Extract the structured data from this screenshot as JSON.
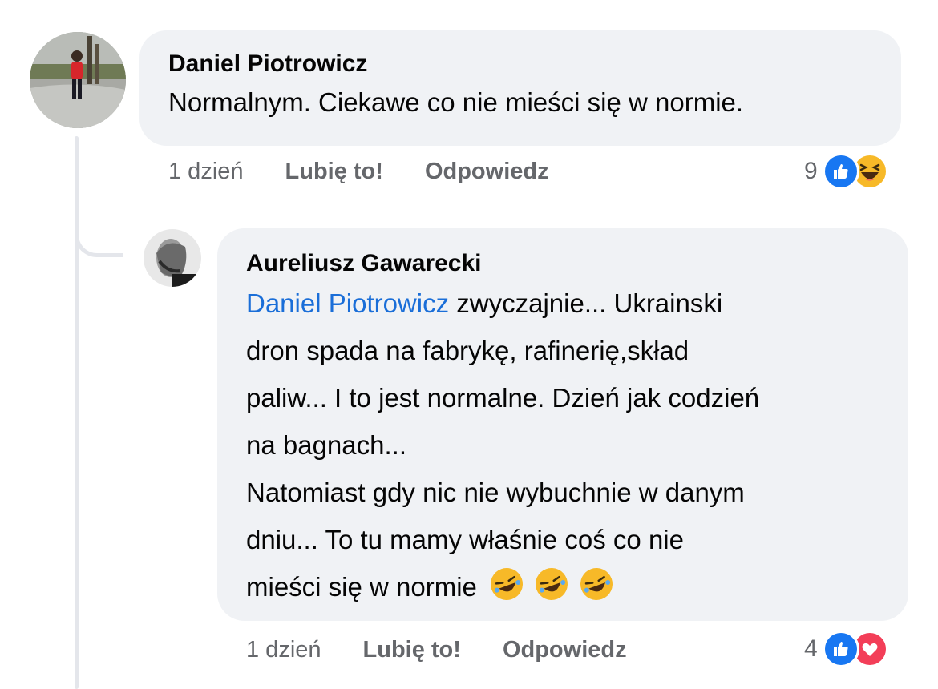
{
  "comments": [
    {
      "author": "Daniel Piotrowicz",
      "text": "Normalnym. Ciekawe co nie mieści się w normie.",
      "time": "1 dzień",
      "like_label": "Lubię to!",
      "reply_label": "Odpowiedz",
      "reaction_count": "9",
      "reactions": [
        "like-icon",
        "haha-icon"
      ]
    }
  ],
  "reply": {
    "author": "Aureliusz Gawarecki",
    "mention": "Daniel Piotrowicz",
    "lines": [
      " zwyczajnie... Ukrainski",
      "dron spada na fabrykę, rafinerię,skład",
      "paliw... I to jest normalne. Dzień jak codzień",
      "na bagnach...",
      "Natomiast gdy nic nie wybuchnie w danym",
      "dniu... To tu mamy właśnie coś co nie",
      "mieści się w normie"
    ],
    "emojis": [
      "rofl-emoji",
      "rofl-emoji",
      "rofl-emoji"
    ],
    "time": "1 dzień",
    "like_label": "Lubię to!",
    "reply_label": "Odpowiedz",
    "reaction_count": "4",
    "reactions": [
      "like-icon",
      "love-icon"
    ]
  },
  "colors": {
    "bubble": "#f0f2f5",
    "mention": "#1a6ed8",
    "like": "#1877f2",
    "haha": "#f7b928",
    "love": "#f33e58",
    "meta": "#65676b"
  }
}
